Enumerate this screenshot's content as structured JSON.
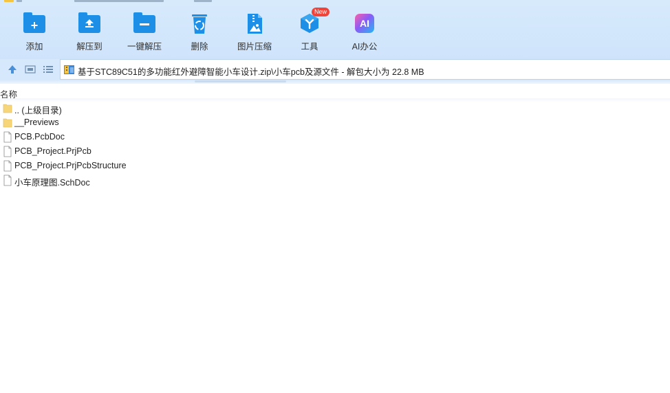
{
  "toolbar": {
    "items": [
      {
        "label": "添加",
        "icon": "add-folder-icon"
      },
      {
        "label": "解压到",
        "icon": "extract-to-icon"
      },
      {
        "label": "一键解压",
        "icon": "one-click-extract-icon"
      },
      {
        "label": "删除",
        "icon": "recycle-bin-icon"
      },
      {
        "label": "图片压缩",
        "icon": "image-compress-icon"
      },
      {
        "label": "工具",
        "icon": "tools-icon"
      },
      {
        "label": "AI办公",
        "icon": "ai-office-icon"
      }
    ],
    "new_badge": "New",
    "ai_glyph": "AI"
  },
  "address": {
    "path": "基于STC89C51的多功能红外避障智能小车设计.zip\\小车pcb及源文件 - 解包大小为 22.8 MB"
  },
  "list": {
    "column_name": "名称",
    "items": [
      {
        "name": ".. (上级目录)",
        "type": "folder"
      },
      {
        "name": "__Previews",
        "type": "folder"
      },
      {
        "name": "PCB.PcbDoc",
        "type": "file"
      },
      {
        "name": "PCB_Project.PrjPcb",
        "type": "file"
      },
      {
        "name": "PCB_Project.PrjPcbStructure",
        "type": "file"
      },
      {
        "name": "小车原理图.SchDoc",
        "type": "file"
      }
    ]
  },
  "colors": {
    "toolbar_bg": "#d7eafc",
    "accent_blue": "#1e8fe6",
    "badge_red": "#f0433a",
    "folder_yellow": "#f7d67a"
  }
}
